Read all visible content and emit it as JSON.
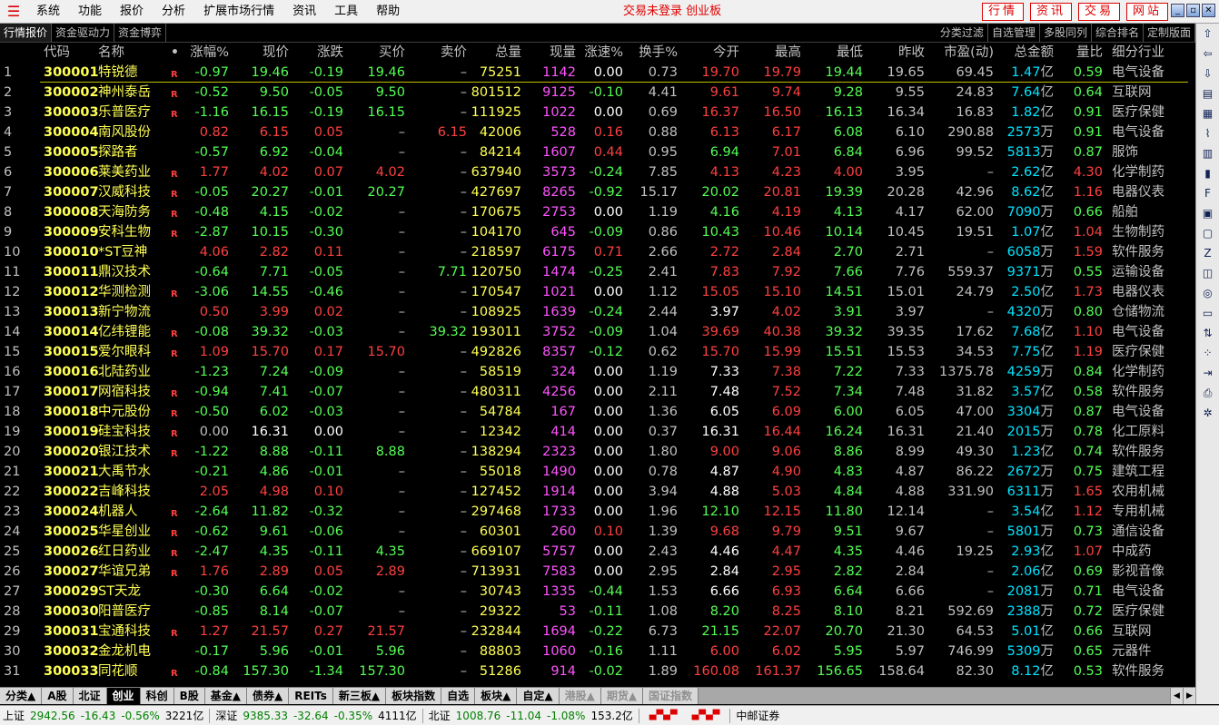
{
  "menu": {
    "logo": "☰",
    "items": [
      "系统",
      "功能",
      "报价",
      "分析",
      "扩展市场行情",
      "资讯",
      "工具",
      "帮助"
    ],
    "center_title": "交易未登录 创业板",
    "right_buttons": [
      "行情",
      "资讯",
      "交易",
      "网站"
    ]
  },
  "top_tabs": [
    "行情报价",
    "资金驱动力",
    "资金博弈"
  ],
  "top_tabs_right": [
    "分类过滤",
    "自选管理",
    "多股同列",
    "综合排名",
    "定制版面"
  ],
  "columns": [
    "",
    "代码",
    "名称",
    "•",
    "涨幅%",
    "现价",
    "涨跌",
    "买价",
    "卖价",
    "总量",
    "现量",
    "涨速%",
    "换手%",
    "今开",
    "最高",
    "最低",
    "昨收",
    "市盈(动)",
    "总金额",
    "量比",
    "细分行业"
  ],
  "rows": [
    {
      "idx": "1",
      "code": "300001",
      "name": "特锐德",
      "mark": "R",
      "chg": "-0.97",
      "px": "19.46",
      "dif": "-0.19",
      "bid": "19.46",
      "ask": "–",
      "vol": "75251",
      "cur": "1142",
      "spd": "0.00",
      "tov": "0.73",
      "open": "19.70",
      "high": "19.79",
      "low": "19.44",
      "pre": "19.65",
      "pe": "69.45",
      "amt": "1.47",
      "unit": "亿",
      "ratio": "0.59",
      "ind": "电气设备"
    },
    {
      "idx": "2",
      "code": "300002",
      "name": "神州泰岳",
      "mark": "R",
      "chg": "-0.52",
      "px": "9.50",
      "dif": "-0.05",
      "bid": "9.50",
      "ask": "–",
      "vol": "801512",
      "cur": "9125",
      "spd": "-0.10",
      "tov": "4.41",
      "open": "9.61",
      "high": "9.74",
      "low": "9.28",
      "pre": "9.55",
      "pe": "24.83",
      "amt": "7.64",
      "unit": "亿",
      "ratio": "0.64",
      "ind": "互联网"
    },
    {
      "idx": "3",
      "code": "300003",
      "name": "乐普医疗",
      "mark": "R",
      "chg": "-1.16",
      "px": "16.15",
      "dif": "-0.19",
      "bid": "16.15",
      "ask": "–",
      "vol": "111925",
      "cur": "1022",
      "spd": "0.00",
      "tov": "0.69",
      "open": "16.37",
      "high": "16.50",
      "low": "16.13",
      "pre": "16.34",
      "pe": "16.83",
      "amt": "1.82",
      "unit": "亿",
      "ratio": "0.91",
      "ind": "医疗保健"
    },
    {
      "idx": "4",
      "code": "300004",
      "name": "南风股份",
      "mark": "",
      "chg": "0.82",
      "px": "6.15",
      "dif": "0.05",
      "bid": "–",
      "ask": "6.15",
      "vol": "42006",
      "cur": "528",
      "spd": "0.16",
      "tov": "0.88",
      "open": "6.13",
      "high": "6.17",
      "low": "6.08",
      "pre": "6.10",
      "pe": "290.88",
      "amt": "2573",
      "unit": "万",
      "ratio": "0.91",
      "ind": "电气设备"
    },
    {
      "idx": "5",
      "code": "300005",
      "name": "探路者",
      "mark": "",
      "chg": "-0.57",
      "px": "6.92",
      "dif": "-0.04",
      "bid": "–",
      "ask": "–",
      "vol": "84214",
      "cur": "1607",
      "spd": "0.44",
      "tov": "0.95",
      "open": "6.94",
      "high": "7.01",
      "low": "6.84",
      "pre": "6.96",
      "pe": "99.52",
      "amt": "5813",
      "unit": "万",
      "ratio": "0.87",
      "ind": "服饰"
    },
    {
      "idx": "6",
      "code": "300006",
      "name": "莱美药业",
      "mark": "R",
      "chg": "1.77",
      "px": "4.02",
      "dif": "0.07",
      "bid": "4.02",
      "ask": "–",
      "vol": "637940",
      "cur": "3573",
      "spd": "-0.24",
      "tov": "7.85",
      "open": "4.13",
      "high": "4.23",
      "low": "4.00",
      "pre": "3.95",
      "pe": "–",
      "amt": "2.62",
      "unit": "亿",
      "ratio": "4.30",
      "ind": "化学制药"
    },
    {
      "idx": "7",
      "code": "300007",
      "name": "汉威科技",
      "mark": "R",
      "chg": "-0.05",
      "px": "20.27",
      "dif": "-0.01",
      "bid": "20.27",
      "ask": "–",
      "vol": "427697",
      "cur": "8265",
      "spd": "-0.92",
      "tov": "15.17",
      "open": "20.02",
      "high": "20.81",
      "low": "19.39",
      "pre": "20.28",
      "pe": "42.96",
      "amt": "8.62",
      "unit": "亿",
      "ratio": "1.16",
      "ind": "电器仪表"
    },
    {
      "idx": "8",
      "code": "300008",
      "name": "天海防务",
      "mark": "R",
      "chg": "-0.48",
      "px": "4.15",
      "dif": "-0.02",
      "bid": "–",
      "ask": "–",
      "vol": "170675",
      "cur": "2753",
      "spd": "0.00",
      "tov": "1.19",
      "open": "4.16",
      "high": "4.19",
      "low": "4.13",
      "pre": "4.17",
      "pe": "62.00",
      "amt": "7090",
      "unit": "万",
      "ratio": "0.66",
      "ind": "船舶"
    },
    {
      "idx": "9",
      "code": "300009",
      "name": "安科生物",
      "mark": "R",
      "chg": "-2.87",
      "px": "10.15",
      "dif": "-0.30",
      "bid": "–",
      "ask": "–",
      "vol": "104170",
      "cur": "645",
      "spd": "-0.09",
      "tov": "0.86",
      "open": "10.43",
      "high": "10.46",
      "low": "10.14",
      "pre": "10.45",
      "pe": "19.51",
      "amt": "1.07",
      "unit": "亿",
      "ratio": "1.04",
      "ind": "生物制药"
    },
    {
      "idx": "10",
      "code": "300010",
      "name": "*ST豆神",
      "mark": "",
      "chg": "4.06",
      "px": "2.82",
      "dif": "0.11",
      "bid": "–",
      "ask": "–",
      "vol": "218597",
      "cur": "6175",
      "spd": "0.71",
      "tov": "2.66",
      "open": "2.72",
      "high": "2.84",
      "low": "2.70",
      "pre": "2.71",
      "pe": "–",
      "amt": "6058",
      "unit": "万",
      "ratio": "1.59",
      "ind": "软件服务"
    },
    {
      "idx": "11",
      "code": "300011",
      "name": "鼎汉技术",
      "mark": "",
      "chg": "-0.64",
      "px": "7.71",
      "dif": "-0.05",
      "bid": "–",
      "ask": "7.71",
      "vol": "120750",
      "cur": "1474",
      "spd": "-0.25",
      "tov": "2.41",
      "open": "7.83",
      "high": "7.92",
      "low": "7.66",
      "pre": "7.76",
      "pe": "559.37",
      "amt": "9371",
      "unit": "万",
      "ratio": "0.55",
      "ind": "运输设备"
    },
    {
      "idx": "12",
      "code": "300012",
      "name": "华测检测",
      "mark": "R",
      "chg": "-3.06",
      "px": "14.55",
      "dif": "-0.46",
      "bid": "–",
      "ask": "–",
      "vol": "170547",
      "cur": "1021",
      "spd": "0.00",
      "tov": "1.12",
      "open": "15.05",
      "high": "15.10",
      "low": "14.51",
      "pre": "15.01",
      "pe": "24.79",
      "amt": "2.50",
      "unit": "亿",
      "ratio": "1.73",
      "ind": "电器仪表"
    },
    {
      "idx": "13",
      "code": "300013",
      "name": "新宁物流",
      "mark": "",
      "chg": "0.50",
      "px": "3.99",
      "dif": "0.02",
      "bid": "–",
      "ask": "–",
      "vol": "108925",
      "cur": "1639",
      "spd": "-0.24",
      "tov": "2.44",
      "open": "3.97",
      "high": "4.02",
      "low": "3.91",
      "pre": "3.97",
      "pe": "–",
      "amt": "4320",
      "unit": "万",
      "ratio": "0.80",
      "ind": "仓储物流"
    },
    {
      "idx": "14",
      "code": "300014",
      "name": "亿纬锂能",
      "mark": "R",
      "chg": "-0.08",
      "px": "39.32",
      "dif": "-0.03",
      "bid": "–",
      "ask": "39.32",
      "vol": "193011",
      "cur": "3752",
      "spd": "-0.09",
      "tov": "1.04",
      "open": "39.69",
      "high": "40.38",
      "low": "39.32",
      "pre": "39.35",
      "pe": "17.62",
      "amt": "7.68",
      "unit": "亿",
      "ratio": "1.10",
      "ind": "电气设备"
    },
    {
      "idx": "15",
      "code": "300015",
      "name": "爱尔眼科",
      "mark": "R",
      "chg": "1.09",
      "px": "15.70",
      "dif": "0.17",
      "bid": "15.70",
      "ask": "–",
      "vol": "492826",
      "cur": "8357",
      "spd": "-0.12",
      "tov": "0.62",
      "open": "15.70",
      "high": "15.99",
      "low": "15.51",
      "pre": "15.53",
      "pe": "34.53",
      "amt": "7.75",
      "unit": "亿",
      "ratio": "1.19",
      "ind": "医疗保健"
    },
    {
      "idx": "16",
      "code": "300016",
      "name": "北陆药业",
      "mark": "",
      "chg": "-1.23",
      "px": "7.24",
      "dif": "-0.09",
      "bid": "–",
      "ask": "–",
      "vol": "58519",
      "cur": "324",
      "spd": "0.00",
      "tov": "1.19",
      "open": "7.33",
      "high": "7.38",
      "low": "7.22",
      "pre": "7.33",
      "pe": "1375.78",
      "amt": "4259",
      "unit": "万",
      "ratio": "0.84",
      "ind": "化学制药"
    },
    {
      "idx": "17",
      "code": "300017",
      "name": "网宿科技",
      "mark": "R",
      "chg": "-0.94",
      "px": "7.41",
      "dif": "-0.07",
      "bid": "–",
      "ask": "–",
      "vol": "480311",
      "cur": "4256",
      "spd": "0.00",
      "tov": "2.11",
      "open": "7.48",
      "high": "7.52",
      "low": "7.34",
      "pre": "7.48",
      "pe": "31.82",
      "amt": "3.57",
      "unit": "亿",
      "ratio": "0.58",
      "ind": "软件服务"
    },
    {
      "idx": "18",
      "code": "300018",
      "name": "中元股份",
      "mark": "R",
      "chg": "-0.50",
      "px": "6.02",
      "dif": "-0.03",
      "bid": "–",
      "ask": "–",
      "vol": "54784",
      "cur": "167",
      "spd": "0.00",
      "tov": "1.36",
      "open": "6.05",
      "high": "6.09",
      "low": "6.00",
      "pre": "6.05",
      "pe": "47.00",
      "amt": "3304",
      "unit": "万",
      "ratio": "0.87",
      "ind": "电气设备"
    },
    {
      "idx": "19",
      "code": "300019",
      "name": "硅宝科技",
      "mark": "R",
      "chg": "0.00",
      "px": "16.31",
      "dif": "0.00",
      "bid": "–",
      "ask": "–",
      "vol": "12342",
      "cur": "414",
      "spd": "0.00",
      "tov": "0.37",
      "open": "16.31",
      "high": "16.44",
      "low": "16.24",
      "pre": "16.31",
      "pe": "21.40",
      "amt": "2015",
      "unit": "万",
      "ratio": "0.78",
      "ind": "化工原料"
    },
    {
      "idx": "20",
      "code": "300020",
      "name": "银江技术",
      "mark": "R",
      "chg": "-1.22",
      "px": "8.88",
      "dif": "-0.11",
      "bid": "8.88",
      "ask": "–",
      "vol": "138294",
      "cur": "2323",
      "spd": "0.00",
      "tov": "1.80",
      "open": "9.00",
      "high": "9.06",
      "low": "8.86",
      "pre": "8.99",
      "pe": "49.30",
      "amt": "1.23",
      "unit": "亿",
      "ratio": "0.74",
      "ind": "软件服务"
    },
    {
      "idx": "21",
      "code": "300021",
      "name": "大禹节水",
      "mark": "",
      "chg": "-0.21",
      "px": "4.86",
      "dif": "-0.01",
      "bid": "–",
      "ask": "–",
      "vol": "55018",
      "cur": "1490",
      "spd": "0.00",
      "tov": "0.78",
      "open": "4.87",
      "high": "4.90",
      "low": "4.83",
      "pre": "4.87",
      "pe": "86.22",
      "amt": "2672",
      "unit": "万",
      "ratio": "0.75",
      "ind": "建筑工程"
    },
    {
      "idx": "22",
      "code": "300022",
      "name": "吉峰科技",
      "mark": "",
      "chg": "2.05",
      "px": "4.98",
      "dif": "0.10",
      "bid": "–",
      "ask": "–",
      "vol": "127452",
      "cur": "1914",
      "spd": "0.00",
      "tov": "3.94",
      "open": "4.88",
      "high": "5.03",
      "low": "4.84",
      "pre": "4.88",
      "pe": "331.90",
      "amt": "6311",
      "unit": "万",
      "ratio": "1.65",
      "ind": "农用机械"
    },
    {
      "idx": "23",
      "code": "300024",
      "name": "机器人",
      "mark": "R",
      "chg": "-2.64",
      "px": "11.82",
      "dif": "-0.32",
      "bid": "–",
      "ask": "–",
      "vol": "297468",
      "cur": "1733",
      "spd": "0.00",
      "tov": "1.96",
      "open": "12.10",
      "high": "12.15",
      "low": "11.80",
      "pre": "12.14",
      "pe": "–",
      "amt": "3.54",
      "unit": "亿",
      "ratio": "1.12",
      "ind": "专用机械"
    },
    {
      "idx": "24",
      "code": "300025",
      "name": "华星创业",
      "mark": "R",
      "chg": "-0.62",
      "px": "9.61",
      "dif": "-0.06",
      "bid": "–",
      "ask": "–",
      "vol": "60301",
      "cur": "260",
      "spd": "0.10",
      "tov": "1.39",
      "open": "9.68",
      "high": "9.79",
      "low": "9.51",
      "pre": "9.67",
      "pe": "–",
      "amt": "5801",
      "unit": "万",
      "ratio": "0.73",
      "ind": "通信设备"
    },
    {
      "idx": "25",
      "code": "300026",
      "name": "红日药业",
      "mark": "R",
      "chg": "-2.47",
      "px": "4.35",
      "dif": "-0.11",
      "bid": "4.35",
      "ask": "–",
      "vol": "669107",
      "cur": "5757",
      "spd": "0.00",
      "tov": "2.43",
      "open": "4.46",
      "high": "4.47",
      "low": "4.35",
      "pre": "4.46",
      "pe": "19.25",
      "amt": "2.93",
      "unit": "亿",
      "ratio": "1.07",
      "ind": "中成药"
    },
    {
      "idx": "26",
      "code": "300027",
      "name": "华谊兄弟",
      "mark": "R",
      "chg": "1.76",
      "px": "2.89",
      "dif": "0.05",
      "bid": "2.89",
      "ask": "–",
      "vol": "713931",
      "cur": "7583",
      "spd": "0.00",
      "tov": "2.95",
      "open": "2.84",
      "high": "2.95",
      "low": "2.82",
      "pre": "2.84",
      "pe": "–",
      "amt": "2.06",
      "unit": "亿",
      "ratio": "0.69",
      "ind": "影视音像"
    },
    {
      "idx": "27",
      "code": "300029",
      "name": "ST天龙",
      "mark": "",
      "chg": "-0.30",
      "px": "6.64",
      "dif": "-0.02",
      "bid": "–",
      "ask": "–",
      "vol": "30743",
      "cur": "1335",
      "spd": "-0.44",
      "tov": "1.53",
      "open": "6.66",
      "high": "6.93",
      "low": "6.64",
      "pre": "6.66",
      "pe": "–",
      "amt": "2081",
      "unit": "万",
      "ratio": "0.71",
      "ind": "电气设备"
    },
    {
      "idx": "28",
      "code": "300030",
      "name": "阳普医疗",
      "mark": "",
      "chg": "-0.85",
      "px": "8.14",
      "dif": "-0.07",
      "bid": "–",
      "ask": "–",
      "vol": "29322",
      "cur": "53",
      "spd": "-0.11",
      "tov": "1.08",
      "open": "8.20",
      "high": "8.25",
      "low": "8.10",
      "pre": "8.21",
      "pe": "592.69",
      "amt": "2388",
      "unit": "万",
      "ratio": "0.72",
      "ind": "医疗保健"
    },
    {
      "idx": "29",
      "code": "300031",
      "name": "宝通科技",
      "mark": "R",
      "chg": "1.27",
      "px": "21.57",
      "dif": "0.27",
      "bid": "21.57",
      "ask": "–",
      "vol": "232844",
      "cur": "1694",
      "spd": "-0.22",
      "tov": "6.73",
      "open": "21.15",
      "high": "22.07",
      "low": "20.70",
      "pre": "21.30",
      "pe": "64.53",
      "amt": "5.01",
      "unit": "亿",
      "ratio": "0.66",
      "ind": "互联网"
    },
    {
      "idx": "30",
      "code": "300032",
      "name": "金龙机电",
      "mark": "",
      "chg": "-0.17",
      "px": "5.96",
      "dif": "-0.01",
      "bid": "5.96",
      "ask": "–",
      "vol": "88803",
      "cur": "1060",
      "spd": "-0.16",
      "tov": "1.11",
      "open": "6.00",
      "high": "6.02",
      "low": "5.95",
      "pre": "5.97",
      "pe": "746.99",
      "amt": "5309",
      "unit": "万",
      "ratio": "0.65",
      "ind": "元器件"
    },
    {
      "idx": "31",
      "code": "300033",
      "name": "同花顺",
      "mark": "R",
      "chg": "-0.84",
      "px": "157.30",
      "dif": "-1.34",
      "bid": "157.30",
      "ask": "–",
      "vol": "51286",
      "cur": "914",
      "spd": "-0.02",
      "tov": "1.89",
      "open": "160.08",
      "high": "161.37",
      "low": "156.65",
      "pre": "158.64",
      "pe": "82.30",
      "amt": "8.12",
      "unit": "亿",
      "ratio": "0.53",
      "ind": "软件服务"
    }
  ],
  "bottom_tabs": [
    {
      "label": "分类▲",
      "state": "normal"
    },
    {
      "label": "A股",
      "state": "normal"
    },
    {
      "label": "北证",
      "state": "normal"
    },
    {
      "label": "创业",
      "state": "active"
    },
    {
      "label": "科创",
      "state": "normal"
    },
    {
      "label": "B股",
      "state": "normal"
    },
    {
      "label": "基金▲",
      "state": "normal"
    },
    {
      "label": "债券▲",
      "state": "normal"
    },
    {
      "label": "REITs",
      "state": "normal"
    },
    {
      "label": "新三板▲",
      "state": "normal"
    },
    {
      "label": "板块指数",
      "state": "normal"
    },
    {
      "label": "自选",
      "state": "normal"
    },
    {
      "label": "板块▲",
      "state": "normal"
    },
    {
      "label": "自定▲",
      "state": "normal"
    },
    {
      "label": "港股▲",
      "state": "gray"
    },
    {
      "label": "期货▲",
      "state": "gray"
    },
    {
      "label": "国证指数",
      "state": "gray"
    }
  ],
  "status": {
    "sh_label": "上证",
    "sh_val": "2942.56",
    "sh_chg": "-16.43",
    "sh_pct": "-0.56%",
    "sh_amt": "3221亿",
    "sz_label": "深证",
    "sz_val": "9385.33",
    "sz_chg": "-32.64",
    "sz_pct": "-0.35%",
    "sz_amt": "4111亿",
    "bz_label": "北证",
    "bz_val": "1008.76",
    "bz_chg": "-11.04",
    "bz_pct": "-1.08%",
    "bz_amt": "153.2亿",
    "broker": "中邮证券"
  }
}
